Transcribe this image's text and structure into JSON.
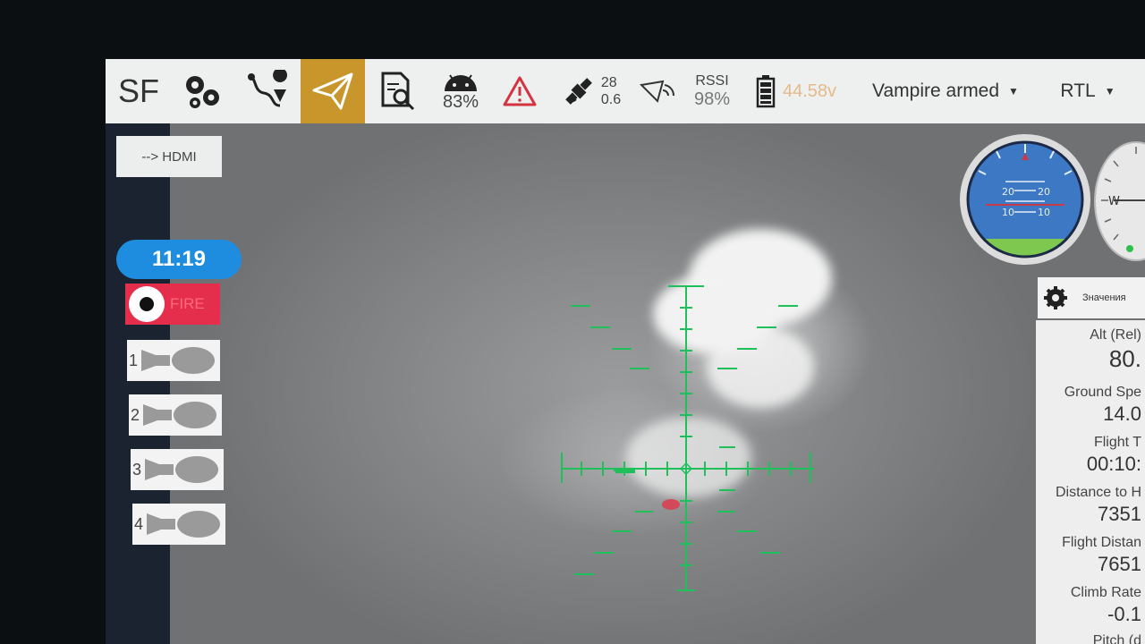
{
  "topbar": {
    "sf_label": "SF",
    "android_battery": "83%",
    "sat_count": "28",
    "hdop": "0.6",
    "rssi_label": "RSSI",
    "rssi_value": "98%",
    "battery_voltage": "44.58v",
    "vehicle_mode": "Vampire armed",
    "flight_mode": "RTL"
  },
  "left_panel": {
    "hdmi_label": "--> HDMI",
    "timer": "11:19",
    "fire_label": "FIRE",
    "bomb_slots": [
      "1",
      "2",
      "3",
      "4"
    ]
  },
  "attitude": {
    "pitch_marks": [
      "20",
      "20",
      "10",
      "10"
    ]
  },
  "compass": {
    "heading_label": "W"
  },
  "telemetry": {
    "header_label": "Значения",
    "items": [
      {
        "label": "Alt (Rel)",
        "value": "80."
      },
      {
        "label": "Ground Spe",
        "value": "14.0"
      },
      {
        "label": "Flight T",
        "value": "00:10:"
      },
      {
        "label": "Distance to H",
        "value": "7351"
      },
      {
        "label": "Flight Distan",
        "value": "7651"
      },
      {
        "label": "Climb Rate",
        "value": "-0.1"
      },
      {
        "label": "Pitch (d",
        "value": ""
      }
    ]
  },
  "colors": {
    "accent_active": "#c8962a",
    "timer_blue": "#1e8de0",
    "fire_red": "#e52e4b",
    "reticle_green": "#1fbf5a",
    "battery_text": "#e6b98a",
    "sky_blue": "#3d78c4",
    "ground_green": "#7ec850"
  },
  "icons": [
    "sf-logo",
    "gear-icon",
    "route-pin-icon",
    "paper-plane-icon",
    "document-search-icon",
    "android-icon",
    "warning-icon",
    "satellite-icon",
    "radio-link-icon",
    "battery-icon",
    "settings-gear-icon",
    "bomb-icon"
  ]
}
